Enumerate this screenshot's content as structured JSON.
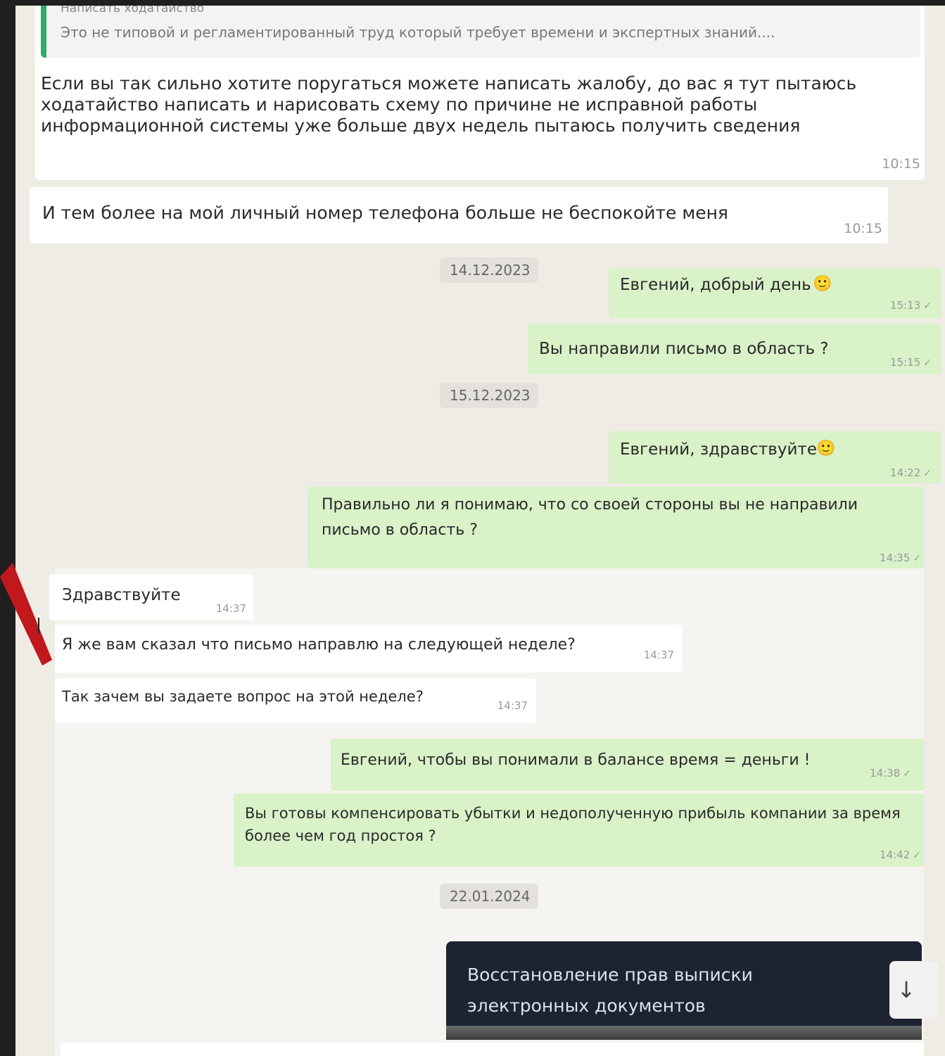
{
  "quoted": {
    "author": "Написать ходатайство",
    "text": "Это не типовой и регламентированный труд который требует времени и экспертных знаний...."
  },
  "messages": {
    "m1": {
      "text": "Если вы так сильно хотите поругаться можете написать жалобу, до вас я тут пытаюсь ходатайство написать и нарисовать схему по причине не исправной работы информационной системы уже больше двух недель пытаюсь получить сведения",
      "time": "10:15"
    },
    "m2": {
      "text": "И тем более на мой личный номер телефона больше не беспокойте меня",
      "time": "10:15"
    },
    "d1": "14.12.2023",
    "m3": {
      "text": "Евгений, добрый день",
      "emoji": "🙂",
      "time": "15:13"
    },
    "m4": {
      "text": "Вы направили письмо в область ?",
      "time": "15:15"
    },
    "d2": "15.12.2023",
    "m5": {
      "text": "Евгений, здравствуйте",
      "emoji": "🙂",
      "time": "14:22"
    },
    "m6": {
      "text": "Правильно ли я понимаю, что со своей стороны вы не направили письмо в область ?",
      "time": "14:35"
    },
    "m7": {
      "text": "Здравствуйте",
      "time": "14:37"
    },
    "m8": {
      "text": "Я же вам сказал что письмо направлю на следующей неделе?",
      "time": "14:37"
    },
    "m9": {
      "text": "Так зачем вы задаете вопрос на этой неделе?",
      "time": "14:37"
    },
    "m10": {
      "text": "Евгений, чтобы вы понимали в балансе время = деньги !",
      "time": "14:38"
    },
    "m11": {
      "text": "Вы готовы компенсировать убытки и недополученную прибыль компании за время более чем год простоя ?",
      "time": "14:42"
    },
    "d3": "22.01.2024",
    "doc": {
      "title": "Восстановление прав выписки электронных документов",
      "icon": "download-icon"
    }
  },
  "colors": {
    "incoming": "#ffffff",
    "outgoing": "#d9f2c8",
    "quote_bar": "#2fae6a",
    "doc_card": "#1d2330",
    "arrow": "#c0181c"
  }
}
